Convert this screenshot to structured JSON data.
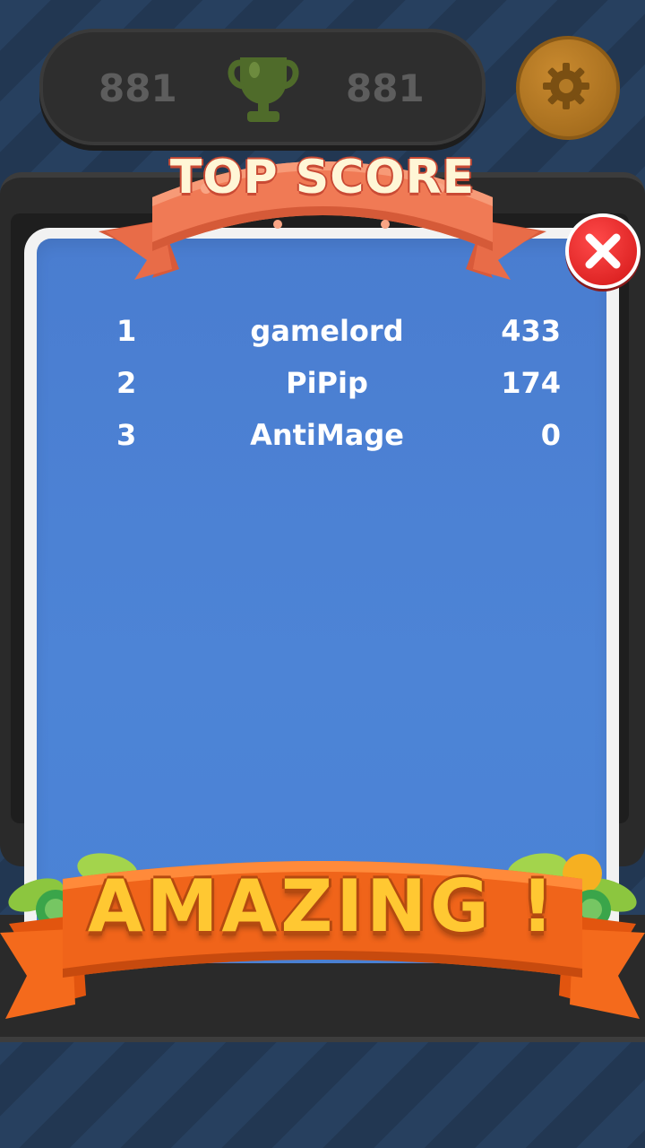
{
  "hud": {
    "current_score": "881",
    "best_score": "881",
    "trophy_icon": "trophy-icon",
    "settings_icon": "gear-icon"
  },
  "popup": {
    "title": "TOP SCORE",
    "close_icon": "close-icon",
    "footer_banner": "AMAZING !",
    "scores": [
      {
        "rank": "1",
        "name": "gamelord",
        "score": "433"
      },
      {
        "rank": "2",
        "name": "PiPip",
        "score": "174"
      },
      {
        "rank": "3",
        "name": "AntiMage",
        "score": "0"
      }
    ]
  },
  "colors": {
    "panel_blue": "#4a82d5",
    "banner_orange": "#f07a55",
    "close_red": "#e32020",
    "amazing_text": "#ffc832"
  }
}
